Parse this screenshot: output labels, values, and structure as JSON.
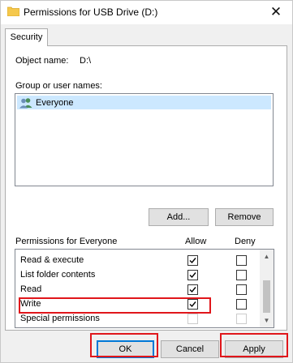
{
  "window": {
    "title": "Permissions for USB Drive (D:)",
    "close_glyph": "✕",
    "icon": "folder-icon"
  },
  "tabs": [
    {
      "label": "Security",
      "active": true
    }
  ],
  "object": {
    "label": "Object name:",
    "value": "D:\\"
  },
  "group": {
    "label": "Group or user names:",
    "items": [
      {
        "name": "Everyone",
        "icon": "users-icon",
        "selected": true
      }
    ]
  },
  "buttons": {
    "add": "Add...",
    "remove": "Remove",
    "ok": "OK",
    "cancel": "Cancel",
    "apply": "Apply"
  },
  "permissions": {
    "label": "Permissions for Everyone",
    "allow_header": "Allow",
    "deny_header": "Deny",
    "rows": [
      {
        "name": "Read & execute",
        "allow": true,
        "deny": false,
        "disabled": false
      },
      {
        "name": "List folder contents",
        "allow": true,
        "deny": false,
        "disabled": false
      },
      {
        "name": "Read",
        "allow": true,
        "deny": false,
        "disabled": false
      },
      {
        "name": "Write",
        "allow": true,
        "deny": false,
        "disabled": false
      },
      {
        "name": "Special permissions",
        "allow": false,
        "deny": false,
        "disabled": true
      }
    ]
  },
  "colors": {
    "highlight": "#e0161b",
    "selection": "#cce8ff",
    "default_button_border": "#0078d7"
  }
}
